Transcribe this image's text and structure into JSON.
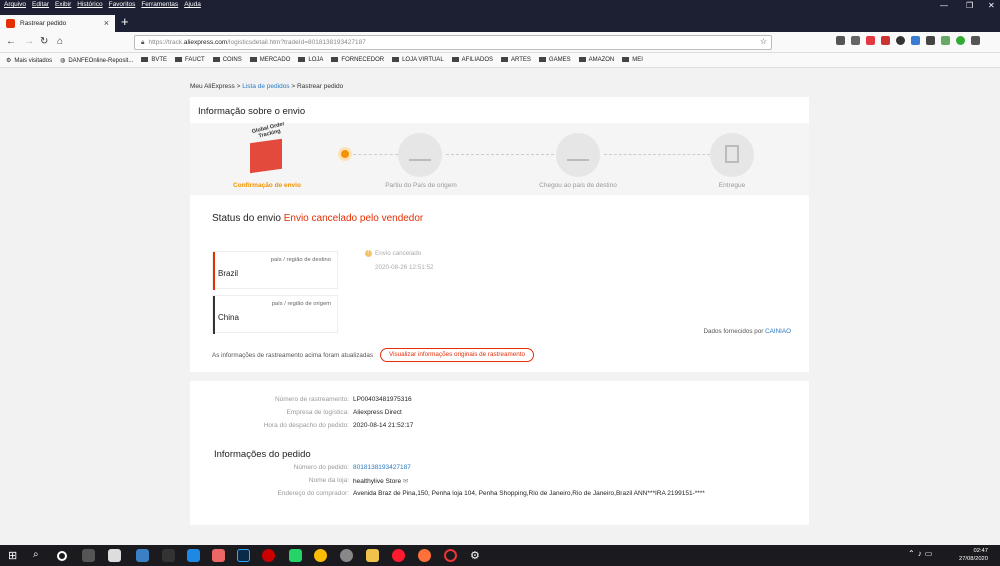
{
  "browser": {
    "menu": [
      "Arquivo",
      "Editar",
      "Exibir",
      "Histórico",
      "Favoritos",
      "Ferramentas",
      "Ajuda"
    ],
    "tab_title": "Rastrear pedido",
    "url_prefix": "https://track.",
    "url_domain": "aliexpress.com",
    "url_path": "/logisticsdetail.htm?tradeId=8018138193427187",
    "bookmarks": [
      "Mais visitados",
      "DANFEOnline-Reposit...",
      "BVTE",
      "FAUCT",
      "COINS",
      "MERCADO",
      "LOJA",
      "FORNECEDOR",
      "LOJA VIRTUAL",
      "AFILIADOS",
      "ARTES",
      "GAMES",
      "AMAZON",
      "MEI"
    ]
  },
  "breadcrumb": {
    "part1": "Meu AliExpress",
    "sep": ">",
    "part2": "Lista de pedidos",
    "part3": "Rastrear pedido"
  },
  "shipping": {
    "title": "Informação sobre o envio",
    "box_text": "Global Order Tracking",
    "steps": [
      "Confirmação de envio",
      "Partiu do País de origem",
      "Chegou ao país de destino",
      "Entregue"
    ],
    "status_label": "Status do envio",
    "status_value": "Envio cancelado pelo vendedor",
    "destination_sub": "país / região de destino",
    "destination_name": "Brazil",
    "origin_sub": "país / região de origem",
    "origin_name": "China",
    "event_text": "Envio cancelado",
    "event_time": "2020-08-26 12:51:52",
    "source_label": "Dados fornecidos por",
    "source_name": "CAINIAO",
    "updated_note": "As informações de rastreamento acima foram atualizadas",
    "view_original_button": "Visualizar informações originais de rastreamento"
  },
  "details": {
    "tracking_label": "Número de rastreamento:",
    "tracking_value": "LP00403481975316",
    "logistics_label": "Empresa de logística:",
    "logistics_value": "Aliexpress Direct",
    "dispatch_label": "Hora do despacho do pedido:",
    "dispatch_value": "2020-08-14 21:52:17",
    "order_heading": "Informações do pedido",
    "order_label": "Número do pedido:",
    "order_value": "8018138193427187",
    "store_label": "Nome da loja:",
    "store_value": "healthylive Store",
    "address_label": "Endereço do comprador:",
    "address_value": "Avenida Braz de Pina,150, Penha loja 104, Penha Shopping,Rio de Janeiro,Rio de Janeiro,Brazil ANN***IRA 2199151-****"
  },
  "taskbar": {
    "time": "02:47",
    "date": "27/08/2020"
  }
}
